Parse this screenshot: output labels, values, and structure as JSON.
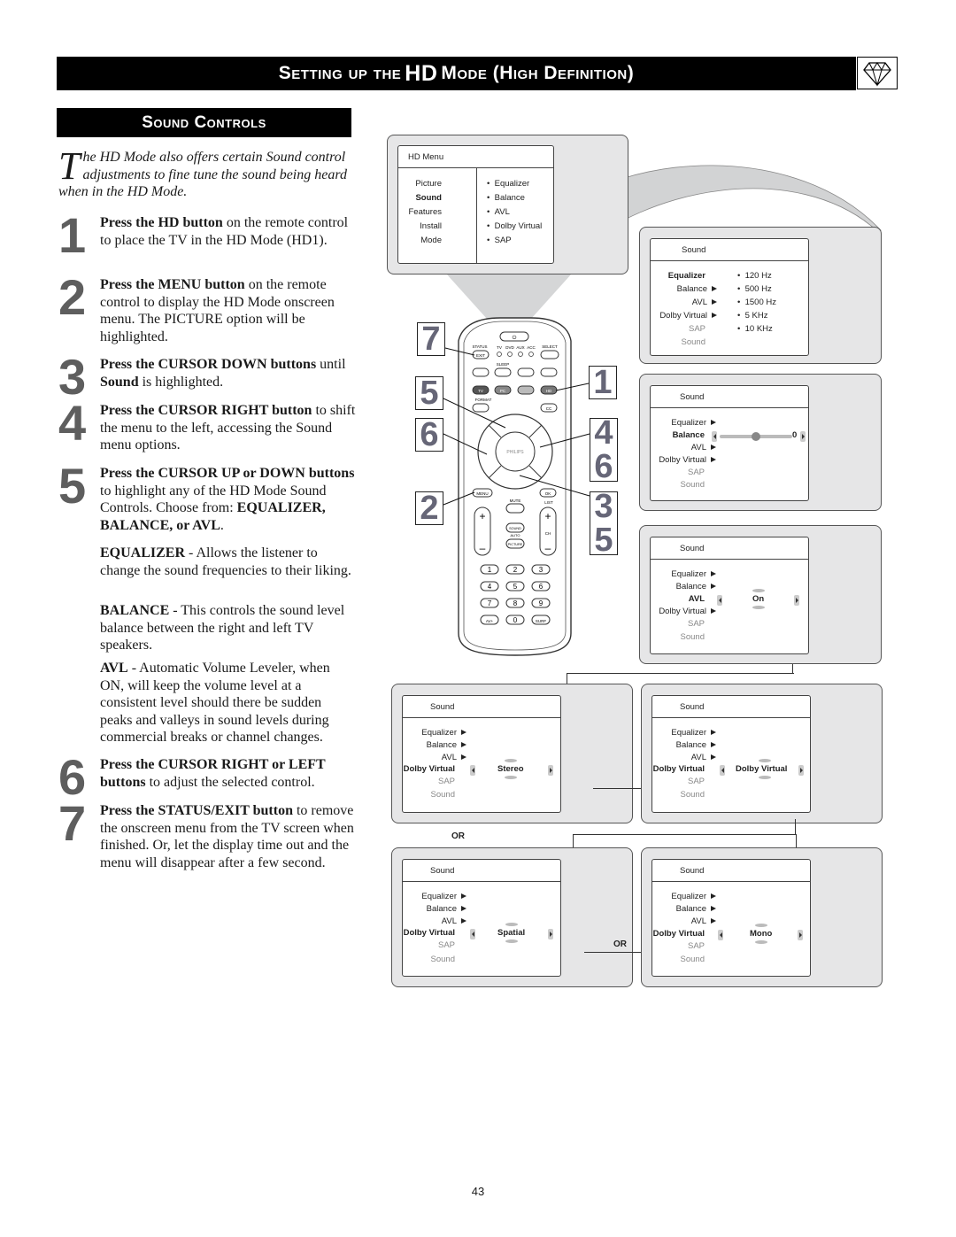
{
  "header": {
    "title_parts": [
      "Setting up the ",
      "HD",
      " Mode (High Definition)"
    ],
    "icon": "diamond-icon"
  },
  "section": {
    "title": "Sound Controls"
  },
  "intro": {
    "dropcap": "T",
    "text": "he HD Mode also offers certain Sound control adjustments to fine tune the sound being heard when in the HD Mode."
  },
  "steps": [
    {
      "num": "1",
      "bold": "Press the HD button",
      "rest": " on the remote control to place the TV in the HD Mode (HD1)."
    },
    {
      "num": "2",
      "bold": "Press the MENU button",
      "rest": " on the remote control to display the HD Mode onscreen menu. The PICTURE option will be highlighted."
    },
    {
      "num": "3",
      "bold": "Press the CURSOR DOWN buttons",
      "rest": " until ",
      "bold2": "Sound",
      "rest2": " is highlighted."
    },
    {
      "num": "4",
      "bold": "Press the CURSOR RIGHT button",
      "rest": " to shift the menu to the left, accessing the Sound menu options."
    },
    {
      "num": "5",
      "bold": "Press the CURSOR UP or DOWN buttons",
      "rest": " to highlight any of the HD Mode Sound Controls. Choose from: ",
      "bold2": "EQUALIZER, BALANCE, or AVL",
      "rest2": "."
    },
    {
      "num": "6",
      "bold": "Press the CURSOR RIGHT or LEFT buttons",
      "rest": " to adjust the selected control."
    },
    {
      "num": "7",
      "bold": "Press the STATUS/EXIT button",
      "rest": " to remove the onscreen menu from the TV screen when finished. Or, let the display time out and the menu will disappear after a few second."
    }
  ],
  "descriptions": [
    {
      "term": "EQUALIZER",
      "text": " - Allows the listener to change the sound frequencies to their liking."
    },
    {
      "term": "BALANCE",
      "text": " - This controls the sound level balance between the right and left TV speakers."
    },
    {
      "term": "AVL",
      "text": " - Automatic Volume Leveler, when ON, will keep the volume level at a consistent level should there be sudden peaks and valleys in sound levels during commercial breaks or channel changes."
    }
  ],
  "hd_menu": {
    "title": "HD Menu",
    "left_items": [
      "Picture",
      "Sound",
      "Features",
      "Install",
      "Mode"
    ],
    "selected_left": "Sound",
    "right_items": [
      "Equalizer",
      "Balance",
      "AVL",
      "Dolby Virtual",
      "SAP"
    ]
  },
  "sound_menus": {
    "title": "Sound",
    "items": [
      "Equalizer",
      "Balance",
      "AVL",
      "Dolby Virtual",
      "SAP",
      "Sound"
    ],
    "equalizer": {
      "selected": "Equalizer",
      "bands": [
        "120 Hz",
        "500 Hz",
        "1500 Hz",
        "5 KHz",
        "10 KHz"
      ]
    },
    "balance": {
      "selected": "Balance",
      "value": "0",
      "slider_fraction": 0.5
    },
    "avl": {
      "selected": "AVL",
      "value": "On"
    },
    "dolby_stereo": {
      "selected": "Dolby Virtual",
      "value": "Stereo"
    },
    "dolby_virtual": {
      "selected": "Dolby Virtual",
      "value": "Dolby Virtual"
    },
    "dolby_spatial": {
      "selected": "Dolby Virtual",
      "value": "Spatial"
    },
    "dolby_mono": {
      "selected": "Dolby Virtual",
      "value": "Mono"
    }
  },
  "or_labels": [
    "OR",
    "OR"
  ],
  "remote": {
    "brand": "PHILIPS",
    "labels": {
      "status": "STATUS",
      "exit": "EXIT",
      "select": "SELECT",
      "tv": "TV",
      "dvd": "DVD",
      "aux": "AUX",
      "acc": "ACC",
      "sleep": "SLEEP",
      "format": "FORMAT",
      "cc": "CC",
      "tv_btn": "TV",
      "pc": "PC",
      "hd": "HD",
      "menu": "MENU",
      "ok": "OK",
      "mute": "MUTE",
      "list": "LIST",
      "sound": "SOUND",
      "auto": "AUTO",
      "picture": "PICTURE",
      "ch": "CH",
      "av": "AV+",
      "surf": "SURF",
      "digits": [
        "1",
        "2",
        "3",
        "4",
        "5",
        "6",
        "7",
        "8",
        "9",
        "0"
      ]
    },
    "callouts": [
      "7",
      "5",
      "6",
      "2",
      "1",
      "4",
      "6",
      "3",
      "5"
    ]
  },
  "page_number": "43"
}
